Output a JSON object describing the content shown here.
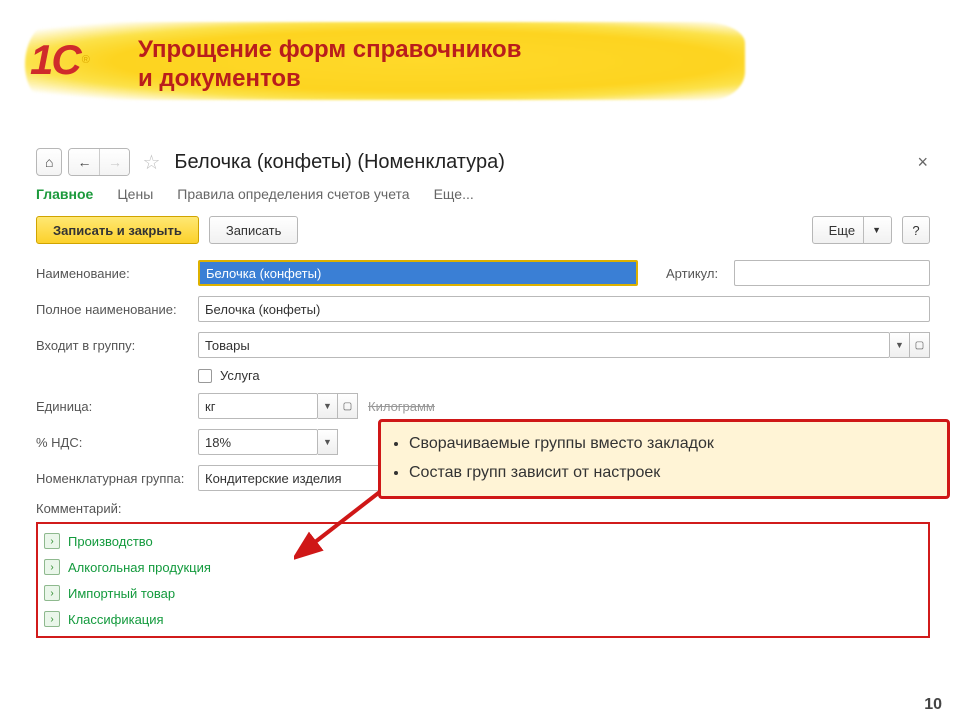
{
  "slide": {
    "title_line1": "Упрощение форм справочников",
    "title_line2": "и документов",
    "page_number": "10",
    "logo_text": "1C",
    "logo_r": "®"
  },
  "titlebar": {
    "doc_title": "Белочка (конфеты) (Номенклатура)"
  },
  "menu": {
    "main": "Главное",
    "prices": "Цены",
    "rules": "Правила определения счетов учета",
    "more": "Еще..."
  },
  "toolbar": {
    "save_close": "Записать и закрыть",
    "save": "Записать",
    "more": "Еще",
    "help": "?"
  },
  "form": {
    "name_lbl": "Наименование:",
    "name_val": "Белочка (конфеты)",
    "article_lbl": "Артикул:",
    "article_val": "",
    "fullname_lbl": "Полное наименование:",
    "fullname_val": "Белочка (конфеты)",
    "group_lbl": "Входит в группу:",
    "group_val": "Товары",
    "service_lbl": "Услуга",
    "unit_lbl": "Единица:",
    "unit_val": "кг",
    "unit_hint": "Килограмм",
    "vat_lbl": "% НДС:",
    "vat_val": "18%",
    "nomgroup_lbl": "Номенклатурная группа:",
    "nomgroup_val": "Кондитерские изделия",
    "comment_lbl": "Комментарий:"
  },
  "groups": [
    "Производство",
    "Алкогольная продукция",
    "Импортный товар",
    "Классификация"
  ],
  "callout": {
    "b1": "Сворачиваемые группы вместо закладок",
    "b2": "Состав групп зависит от настроек"
  }
}
